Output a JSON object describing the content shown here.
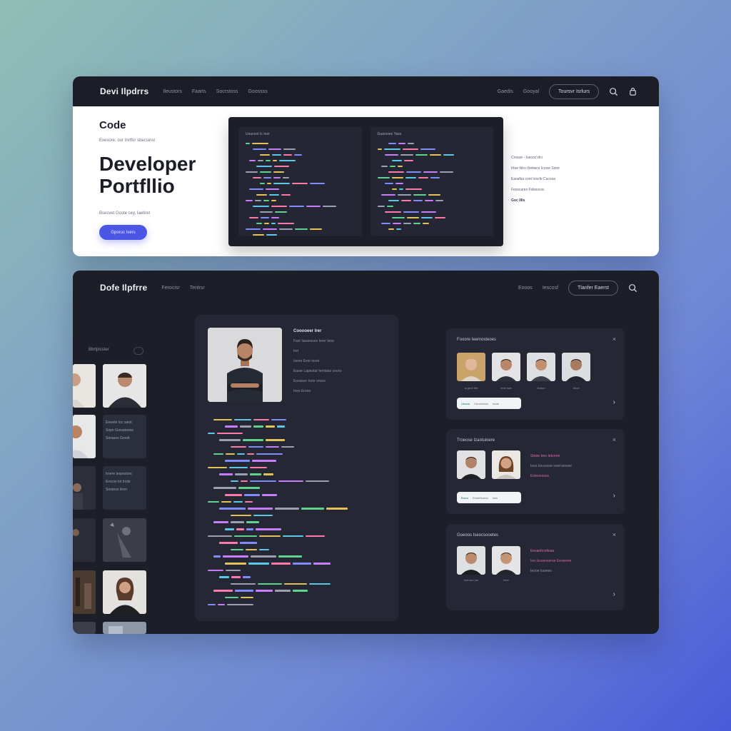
{
  "top": {
    "logo": "Devi Ilpdrrs",
    "nav": [
      "Ileustors",
      "Faarts",
      "Socrstoss",
      "Goossss"
    ],
    "nav_right": [
      "Gaedis",
      "Gooyal"
    ],
    "nav_button": "Toursvr Isrlurs",
    "hero": {
      "kicker": "Code",
      "subtitle": "Exesore, our Inrtfor sbecsinst",
      "title_line1": "Developer",
      "title_line2": "Portfllio",
      "note": "Bsesvet Goste cey, Iaetiret",
      "cta": "Gporuc Ivers"
    },
    "code_panes": [
      "Uoucoot Ic   Ioor",
      "Guarsoes   Yass"
    ],
    "side_links": [
      "Crosue - Iuecoc'sfcr",
      "Irtoe fslro Ilontwcs Iccsre Sstor",
      "Easafas cont Ioscfe Cucosa",
      "Fesscarex Fslesscoc",
      "Goc IIIIs"
    ]
  },
  "bottom": {
    "logo": "Dofe Ilpfrre",
    "nav": [
      "Ferocisr",
      "Tenlrsr"
    ],
    "nav_right": [
      "Eooos",
      "Iescosf"
    ],
    "nav_button": "Tlanfer Eaerst",
    "gallery_label": "Bbrtpisster",
    "gallery_texts": [
      [
        "Eewste Ioc sarst",
        "Sopn Gresatooos",
        "Soraaos Gorstt"
      ],
      [
        "Irnere Ierpestors",
        "Erecos Iot Inste",
        "Sreanss Ierrn"
      ]
    ],
    "profile": {
      "title": "Cooooeer Irer",
      "lines": [
        "Fasr Iasaeosex Ierer Ieoe",
        "Irer",
        "Iseoe Eesr tocet",
        "Easer Lapestar Iemtatsr sooro",
        "Eossiesr Inror sroeo",
        "Ieso  Erooo"
      ]
    },
    "teams": [
      {
        "title": "Fooore Ieemosteoes",
        "captions": [
          "Ia gecf Ifre",
          "Iede Iuar",
          "Ilotsor",
          "Ileod"
        ],
        "pill_tag": "Ueoso",
        "pill_text": "Ceorrectoo",
        "pill_extra": "Ioote"
      },
      {
        "title": "Troeose Izaotuioere",
        "side_lines": [
          "Stnoe Ireo Ietcrore",
          "Ioos Ioccsooe soorosoose",
          "Esteonosos"
        ],
        "pill_tag": "Eooo",
        "pill_text": "Eeserfoores",
        "pill_extra": "Ioes"
      },
      {
        "title": "Goeoos Iseocsooetes",
        "side_lines": [
          "Eesaotrceltoae",
          "Ieo Iscoeoseroe Eeserere",
          "Ieooe Iuweeo"
        ],
        "captions": [
          "Ieeroeo Ioe",
          "Ieee"
        ]
      }
    ]
  }
}
